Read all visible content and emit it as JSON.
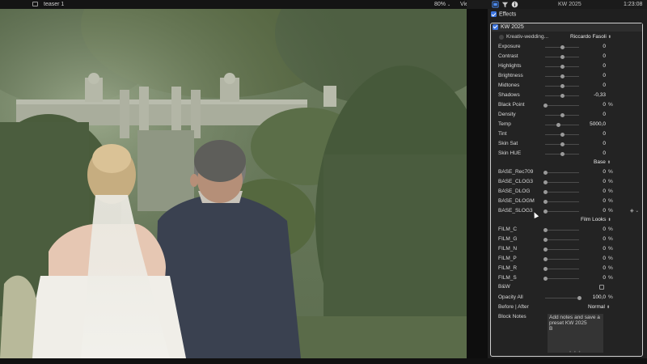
{
  "topbar": {
    "clip_title": "teaser 1",
    "zoom": "80%",
    "view_label": "View",
    "inspector_title": "KW 2025",
    "timecode": "1:23:08"
  },
  "effects": {
    "header": "Effects",
    "block_title": "KW 2025",
    "preset_menu": "Kreativ-wedding...",
    "author_menu": "Riccardo Fasoli"
  },
  "base_params": [
    {
      "label": "Exposure",
      "value": "0",
      "unit": "",
      "level": 0.5
    },
    {
      "label": "Contrast",
      "value": "0",
      "unit": "",
      "level": 0.5
    },
    {
      "label": "Highlights",
      "value": "0",
      "unit": "",
      "level": 0.5
    },
    {
      "label": "Brightness",
      "value": "0",
      "unit": "",
      "level": 0.5
    },
    {
      "label": "Midtones",
      "value": "0",
      "unit": "",
      "level": 0.5
    },
    {
      "label": "Shadows",
      "value": "-0,33",
      "unit": "",
      "level": 0.5
    },
    {
      "label": "Black Point",
      "value": "0",
      "unit": "%",
      "level": 0
    },
    {
      "label": "Density",
      "value": "0",
      "unit": "",
      "level": 0.5
    },
    {
      "label": "Temp",
      "value": "5000,0",
      "unit": "",
      "level": 0.4
    },
    {
      "label": "Tint",
      "value": "0",
      "unit": "",
      "level": 0.5
    },
    {
      "label": "Skin Sat",
      "value": "0",
      "unit": "",
      "level": 0.5
    },
    {
      "label": "Skin HUE",
      "value": "0",
      "unit": "",
      "level": 0.5
    }
  ],
  "base_section": "Base",
  "base_layers": [
    {
      "label": "BASE_Rec709",
      "value": "0",
      "unit": "%",
      "level": 0
    },
    {
      "label": "BASE_CLOG3",
      "value": "0",
      "unit": "%",
      "level": 0
    },
    {
      "label": "BASE_DLOG",
      "value": "0",
      "unit": "%",
      "level": 0
    },
    {
      "label": "BASE_DLOGM",
      "value": "0",
      "unit": "%",
      "level": 0
    },
    {
      "label": "BASE_SLOG3",
      "value": "0",
      "unit": "%",
      "level": 0
    }
  ],
  "film_section": "Film Looks",
  "film_layers": [
    {
      "label": "FILM_C",
      "value": "0",
      "unit": "%",
      "level": 0
    },
    {
      "label": "FILM_G",
      "value": "0",
      "unit": "%",
      "level": 0
    },
    {
      "label": "FILM_N",
      "value": "0",
      "unit": "%",
      "level": 0
    },
    {
      "label": "FILM_P",
      "value": "0",
      "unit": "%",
      "level": 0
    },
    {
      "label": "FILM_R",
      "value": "0",
      "unit": "%",
      "level": 0
    },
    {
      "label": "FILM_S",
      "value": "0",
      "unit": "%",
      "level": 0
    }
  ],
  "bw": {
    "label": "B&W",
    "checked": false
  },
  "opacity": {
    "label": "Opacity All",
    "value": "100,0",
    "unit": "%",
    "level": 1
  },
  "blend": {
    "label": "Before | After",
    "value": "Normal"
  },
  "notes": {
    "label": "Block Notes",
    "text": "Add notes and save a preset KW 2025\nB"
  },
  "colors": {
    "accent": "#3b74e0",
    "panel": "#232323",
    "border": "#cfcfcf"
  }
}
